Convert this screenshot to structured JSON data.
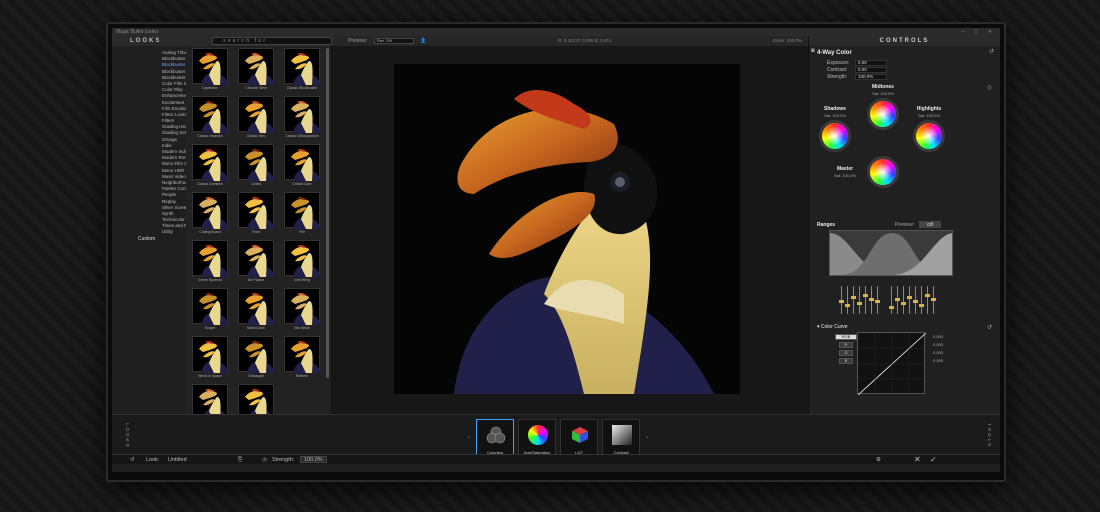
{
  "window": {
    "title": "Magic Bullet Looks",
    "controls": "– ▢ ✕"
  },
  "looks_panel": {
    "header": "LOOKS",
    "search_placeholder": "search for",
    "categories": [
      "Analog Tribe",
      "Blockbuster",
      "Blockbuster Cool",
      "Blockbuster HDR",
      "Blockbuster Warm",
      "Color Film Stock",
      "Color Play",
      "Enhancements",
      "Excitement",
      "Film Emulation",
      "Filmic Looks",
      "Filters",
      "Grading Headstarts",
      "Grading Setups",
      "Grunge",
      "Indie",
      "Modern Indie",
      "Modern Romance",
      "Mono Film Stock",
      "Mono HDR",
      "Music video",
      "Neighborhood",
      "Palette Control",
      "People",
      "Replay",
      "Silver Screen",
      "Synth",
      "Technicolor",
      "Times and Places",
      "Utility"
    ],
    "active_category": "Blockbuster Cool",
    "custom_label": "Custom",
    "thumbs": [
      "Capetown",
      "Chrome Steel",
      "Classic Blockbuster",
      "Classic Invasion",
      "Classic Neo",
      "Classic Ultraquantum",
      "Classic Zombies",
      "Cullins",
      "Critical Care",
      "Cutting Board",
      "Frost",
      "Fire",
      "Green Sparrow",
      "Ice Palace",
      "Iced Wing",
      "Kruger",
      "Miami Dark",
      "Neo Neue",
      "Nerds in Space",
      "Onslaught",
      "Rethem",
      "",
      ""
    ]
  },
  "topbar": {
    "preview_label": "Preview:",
    "preview_value": "Rec.709",
    "rgb_readout": "R: 0.423   G: 0.396   B: 0.412",
    "zoom": "Zoom: 100.0%"
  },
  "controls": {
    "header": "CONTROLS",
    "tool_title": "4-Way Color",
    "exposure_label": "Exposure:",
    "exposure_value": "0.00",
    "contrast_label": "Contrast:",
    "contrast_value": "0.00",
    "strength_label": "Strength:",
    "strength_value": "100.0%",
    "midtones_label": "Midtones",
    "midtones_sat": "Sat: 100.0%",
    "shadows_label": "Shadows",
    "shadows_sat": "Sat: 100.0%",
    "highlights_label": "Highlights",
    "highlights_sat": "Sat: 100.0%",
    "master_label": "Master",
    "master_sat": "Sat: 100.0%",
    "ranges_label": "Ranges",
    "ranges_preview_label": "Preview:",
    "ranges_preview_value": "Off",
    "curve_title": "Color Curve",
    "curve_buttons": [
      "RGB",
      "R",
      "G",
      "B"
    ],
    "curve_values": [
      "0.000",
      "0.000",
      "0.000",
      "0.000"
    ]
  },
  "tools": {
    "left_tab": "LOOKS",
    "right_tab": "TOOLS",
    "items": [
      {
        "label": "Colorista",
        "icon": "colorista-icon"
      },
      {
        "label": "Hue/Saturation",
        "icon": "hue-saturation-icon"
      },
      {
        "label": "LUT",
        "icon": "lut-cube-icon"
      },
      {
        "label": "Contrast",
        "icon": "contrast-icon"
      }
    ]
  },
  "status": {
    "look_label": "Look:",
    "look_value": "Untitled",
    "strength_label": "Strength:",
    "strength_value": "100.0%"
  }
}
